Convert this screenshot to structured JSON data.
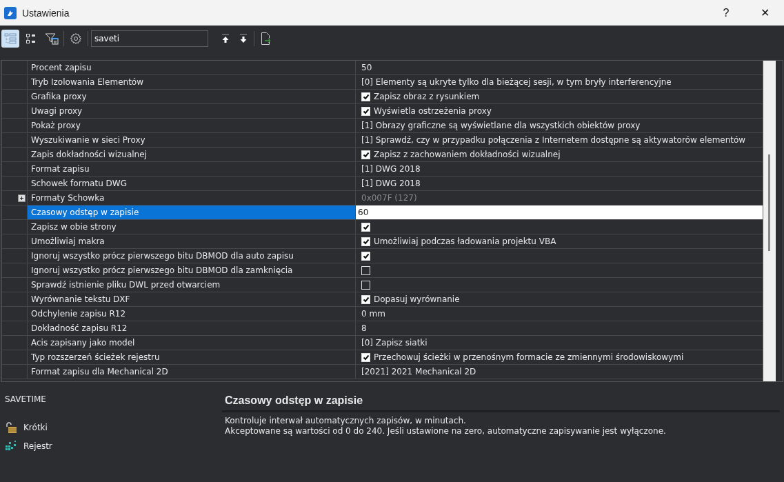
{
  "window": {
    "title": "Ustawienia",
    "help": "?",
    "close": "✕"
  },
  "toolbar": {
    "view_buttons": [
      {
        "selected": true
      },
      {
        "selected": false
      }
    ],
    "search": {
      "value": "saveti"
    }
  },
  "grid": {
    "rows": [
      {
        "name": "Procent zapisu",
        "kind": "text",
        "value": "50"
      },
      {
        "name": "Tryb Izolowania Elementów",
        "kind": "text",
        "value": "[0] Elementy są ukryte tylko dla bieżącej sesji, w tym bryły interferencyjne"
      },
      {
        "name": "Grafika proxy",
        "kind": "check",
        "checked": true,
        "value": "Zapisz obraz z rysunkiem"
      },
      {
        "name": "Uwagi proxy",
        "kind": "check",
        "checked": true,
        "value": "Wyświetla ostrzeżenia proxy"
      },
      {
        "name": "Pokaż proxy",
        "kind": "text",
        "value": "[1] Obrazy graficzne są wyświetlane dla wszystkich obiektów proxy"
      },
      {
        "name": "Wyszukiwanie w sieci Proxy",
        "kind": "text",
        "value": "[1] Sprawdź, czy w przypadku połączenia z Internetem dostępne są aktywatorów elementów"
      },
      {
        "name": "Zapis dokładności wizualnej",
        "kind": "check",
        "checked": true,
        "value": "Zapisz z zachowaniem dokładności wizualnej"
      },
      {
        "name": "Format zapisu",
        "kind": "text",
        "value": "[1] DWG 2018"
      },
      {
        "name": "Schowek formatu DWG",
        "kind": "text",
        "value": "[1] DWG 2018"
      },
      {
        "name": "Formaty Schowka",
        "kind": "group",
        "expanded": false,
        "value": "0x007F (127)"
      },
      {
        "name": "Czasowy odstęp w zapisie",
        "kind": "edit",
        "selected": true,
        "value": "60"
      },
      {
        "name": "Zapisz w obie strony",
        "kind": "check",
        "checked": true
      },
      {
        "name": "Umożliwiaj makra",
        "kind": "check",
        "checked": true,
        "value": "Umożliwiaj podczas ładowania projektu VBA"
      },
      {
        "name": "Ignoruj wszystko prócz pierwszego bitu DBMOD dla auto zapisu",
        "kind": "check",
        "checked": true
      },
      {
        "name": "Ignoruj wszystko prócz pierwszego bitu DBMOD dla zamknięcia",
        "kind": "check",
        "checked": false
      },
      {
        "name": "Sprawdź istnienie pliku DWL przed otwarciem",
        "kind": "check",
        "checked": false
      },
      {
        "name": "Wyrównanie tekstu DXF",
        "kind": "check",
        "checked": true,
        "value": "Dopasuj wyrównanie"
      },
      {
        "name": "Odchylenie zapisu R12",
        "kind": "text",
        "value": "0 mm"
      },
      {
        "name": "Dokładność zapisu R12",
        "kind": "text",
        "value": "8"
      },
      {
        "name": "Acis zapisany jako model",
        "kind": "text",
        "value": "[0] Zapisz siatki"
      },
      {
        "name": "Typ rozszerzeń ścieżek rejestru",
        "kind": "check",
        "checked": true,
        "value": "Przechowuj ścieżki w przenośnym formacie ze zmiennymi środowiskowymi"
      },
      {
        "name": "Format zapisu dla Mechanical 2D",
        "kind": "text",
        "value": "[2021] 2021 Mechanical 2D"
      }
    ]
  },
  "info": {
    "variable": "SAVETIME",
    "links": [
      {
        "kind": "short",
        "label": "Krótki"
      },
      {
        "kind": "registry",
        "label": "Rejestr"
      }
    ],
    "title": "Czasowy odstęp w zapisie",
    "lines": [
      "Kontroluje interwał automatycznych zapisów, w minutach.",
      "Akceptowane są wartości od 0 do 240. Jeśli ustawione na zero, automatyczne zapisywanie jest wyłączone."
    ]
  }
}
